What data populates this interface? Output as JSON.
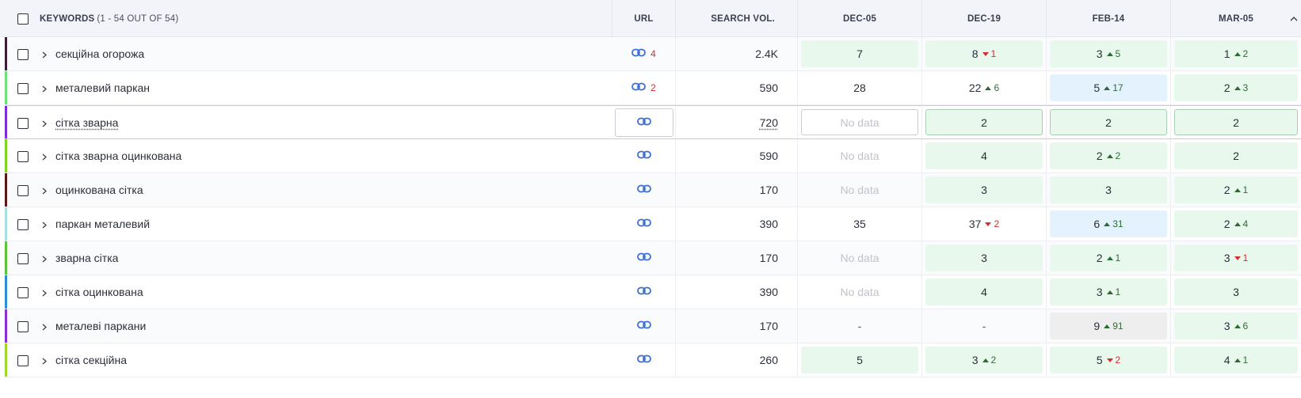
{
  "header": {
    "keywords_label": "KEYWORDS",
    "keywords_count": "(1 - 54 OUT OF 54)",
    "url_label": "URL",
    "volume_label": "SEARCH VOL.",
    "dates": [
      "DEC-05",
      "DEC-19",
      "FEB-14",
      "MAR-05"
    ]
  },
  "colors": {
    "green_cell": "#e9f8ec",
    "blue_cell": "#e3f2fc",
    "gray_cell": "#eeeeee",
    "up": "#2e6b34",
    "down": "#d32f2f",
    "link": "#3b6fd4"
  },
  "rows": [
    {
      "keyword": "секційна огорожа",
      "accent": "#3b1f3a",
      "url_count": "4",
      "volume": "2.4K",
      "pos": [
        {
          "v": "7",
          "bg": "green"
        },
        {
          "v": "8",
          "d": "1",
          "dir": "down",
          "bg": "green"
        },
        {
          "v": "3",
          "d": "5",
          "dir": "up",
          "bg": "green"
        },
        {
          "v": "1",
          "d": "2",
          "dir": "up",
          "bg": "green"
        }
      ]
    },
    {
      "keyword": "металевий паркан",
      "accent": "#6ee07a",
      "url_count": "2",
      "volume": "590",
      "pos": [
        {
          "v": "28",
          "bg": "none"
        },
        {
          "v": "22",
          "d": "6",
          "dir": "up",
          "bg": "none"
        },
        {
          "v": "5",
          "d": "17",
          "dir": "up",
          "bg": "blue"
        },
        {
          "v": "2",
          "d": "3",
          "dir": "up",
          "bg": "green"
        }
      ]
    },
    {
      "keyword": "сітка зварна",
      "accent": "#7b2fd6",
      "url_count": "",
      "volume": "720",
      "selected": true,
      "pos": [
        {
          "v": "No data",
          "bg": "nodata"
        },
        {
          "v": "2",
          "bg": "green-bordered"
        },
        {
          "v": "2",
          "bg": "green-bordered"
        },
        {
          "v": "2",
          "bg": "green-bordered"
        }
      ]
    },
    {
      "keyword": "сітка зварна оцинкована",
      "accent": "#7ed321",
      "url_count": "",
      "volume": "590",
      "pos": [
        {
          "v": "No data",
          "bg": "muted"
        },
        {
          "v": "4",
          "bg": "green"
        },
        {
          "v": "2",
          "d": "2",
          "dir": "up",
          "bg": "green"
        },
        {
          "v": "2",
          "bg": "green"
        }
      ]
    },
    {
      "keyword": "оцинкована сітка",
      "accent": "#5a1a1a",
      "url_count": "",
      "volume": "170",
      "pos": [
        {
          "v": "No data",
          "bg": "muted"
        },
        {
          "v": "3",
          "bg": "green"
        },
        {
          "v": "3",
          "bg": "green"
        },
        {
          "v": "2",
          "d": "1",
          "dir": "up",
          "bg": "green"
        }
      ]
    },
    {
      "keyword": "паркан металевий",
      "accent": "#a8dfe6",
      "url_count": "",
      "volume": "390",
      "pos": [
        {
          "v": "35",
          "bg": "none"
        },
        {
          "v": "37",
          "d": "2",
          "dir": "down",
          "bg": "none"
        },
        {
          "v": "6",
          "d": "31",
          "dir": "up",
          "bg": "blue"
        },
        {
          "v": "2",
          "d": "4",
          "dir": "up",
          "bg": "green"
        }
      ]
    },
    {
      "keyword": "зварна сітка",
      "accent": "#5cc236",
      "url_count": "",
      "volume": "170",
      "pos": [
        {
          "v": "No data",
          "bg": "muted"
        },
        {
          "v": "3",
          "bg": "green"
        },
        {
          "v": "2",
          "d": "1",
          "dir": "up",
          "bg": "green"
        },
        {
          "v": "3",
          "d": "1",
          "dir": "down",
          "bg": "green"
        }
      ]
    },
    {
      "keyword": "сітка оцинкована",
      "accent": "#2a8fd6",
      "url_count": "",
      "volume": "390",
      "pos": [
        {
          "v": "No data",
          "bg": "muted"
        },
        {
          "v": "4",
          "bg": "green"
        },
        {
          "v": "3",
          "d": "1",
          "dir": "up",
          "bg": "green"
        },
        {
          "v": "3",
          "bg": "green"
        }
      ]
    },
    {
      "keyword": "металеві паркани",
      "accent": "#8a2fd6",
      "url_count": "",
      "volume": "170",
      "pos": [
        {
          "v": "-",
          "bg": "dash"
        },
        {
          "v": "-",
          "bg": "dash"
        },
        {
          "v": "9",
          "d": "91",
          "dir": "up",
          "bg": "gray"
        },
        {
          "v": "3",
          "d": "6",
          "dir": "up",
          "bg": "green"
        }
      ]
    },
    {
      "keyword": "сітка секційна",
      "accent": "#9fd62a",
      "url_count": "",
      "volume": "260",
      "pos": [
        {
          "v": "5",
          "bg": "green"
        },
        {
          "v": "3",
          "d": "2",
          "dir": "up",
          "bg": "green"
        },
        {
          "v": "5",
          "d": "2",
          "dir": "down",
          "bg": "green"
        },
        {
          "v": "4",
          "d": "1",
          "dir": "up",
          "bg": "green"
        }
      ]
    }
  ]
}
